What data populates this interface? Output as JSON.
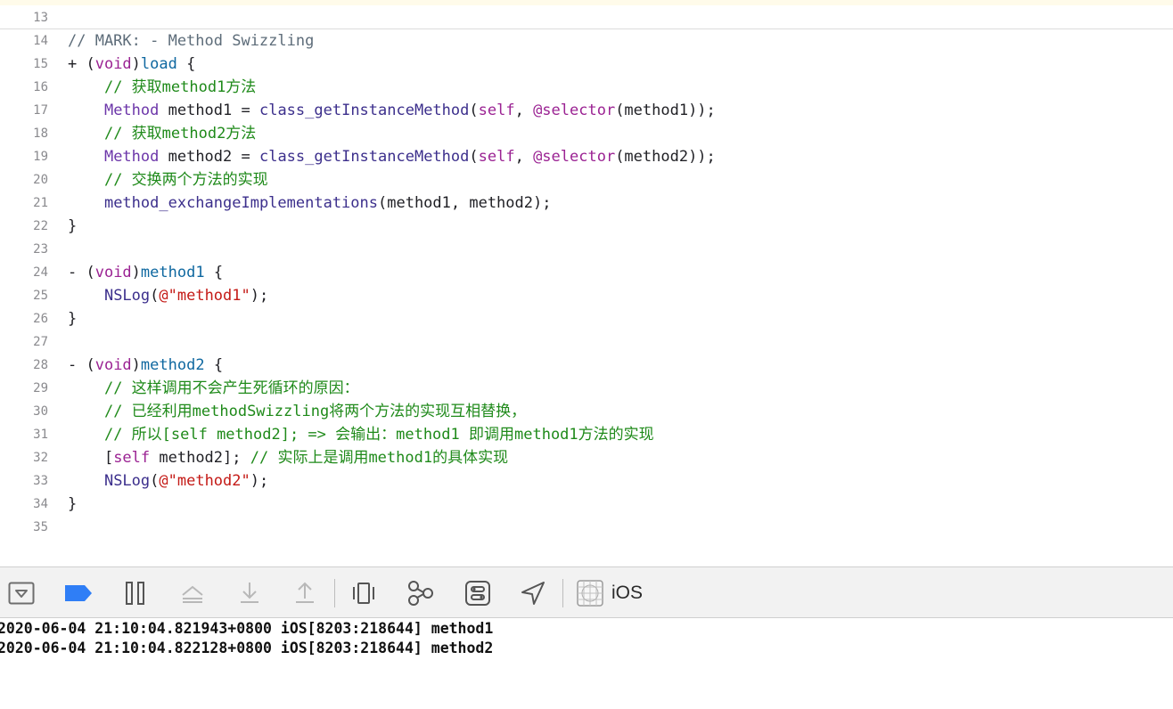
{
  "editor": {
    "lines": [
      {
        "num": "13",
        "tokens": []
      },
      {
        "num": "14",
        "tokens": [
          {
            "t": "// MARK: - Method Swizzling",
            "c": "comment-gray"
          }
        ]
      },
      {
        "num": "15",
        "tokens": [
          {
            "t": "+ (",
            "c": "plain"
          },
          {
            "t": "void",
            "c": "keyword"
          },
          {
            "t": ")",
            "c": "plain"
          },
          {
            "t": "load",
            "c": "decl"
          },
          {
            "t": " {",
            "c": "plain"
          }
        ]
      },
      {
        "num": "16",
        "tokens": [
          {
            "t": "    ",
            "c": "plain"
          },
          {
            "t": "// 获取method1方法",
            "c": "comment"
          }
        ]
      },
      {
        "num": "17",
        "tokens": [
          {
            "t": "    ",
            "c": "plain"
          },
          {
            "t": "Method",
            "c": "type"
          },
          {
            "t": " method1 = ",
            "c": "plain"
          },
          {
            "t": "class_getInstanceMethod",
            "c": "func"
          },
          {
            "t": "(",
            "c": "plain"
          },
          {
            "t": "self",
            "c": "keyword"
          },
          {
            "t": ", ",
            "c": "plain"
          },
          {
            "t": "@selector",
            "c": "keyword"
          },
          {
            "t": "(method1));",
            "c": "plain"
          }
        ]
      },
      {
        "num": "18",
        "tokens": [
          {
            "t": "    ",
            "c": "plain"
          },
          {
            "t": "// 获取method2方法",
            "c": "comment"
          }
        ]
      },
      {
        "num": "19",
        "tokens": [
          {
            "t": "    ",
            "c": "plain"
          },
          {
            "t": "Method",
            "c": "type"
          },
          {
            "t": " method2 = ",
            "c": "plain"
          },
          {
            "t": "class_getInstanceMethod",
            "c": "func"
          },
          {
            "t": "(",
            "c": "plain"
          },
          {
            "t": "self",
            "c": "keyword"
          },
          {
            "t": ", ",
            "c": "plain"
          },
          {
            "t": "@selector",
            "c": "keyword"
          },
          {
            "t": "(method2));",
            "c": "plain"
          }
        ]
      },
      {
        "num": "20",
        "tokens": [
          {
            "t": "    ",
            "c": "plain"
          },
          {
            "t": "// 交换两个方法的实现",
            "c": "comment"
          }
        ]
      },
      {
        "num": "21",
        "tokens": [
          {
            "t": "    ",
            "c": "plain"
          },
          {
            "t": "method_exchangeImplementations",
            "c": "func"
          },
          {
            "t": "(method1, method2);",
            "c": "plain"
          }
        ]
      },
      {
        "num": "22",
        "tokens": [
          {
            "t": "}",
            "c": "plain"
          }
        ]
      },
      {
        "num": "23",
        "tokens": []
      },
      {
        "num": "24",
        "tokens": [
          {
            "t": "- (",
            "c": "plain"
          },
          {
            "t": "void",
            "c": "keyword"
          },
          {
            "t": ")",
            "c": "plain"
          },
          {
            "t": "method1",
            "c": "decl"
          },
          {
            "t": " {",
            "c": "plain"
          }
        ]
      },
      {
        "num": "25",
        "tokens": [
          {
            "t": "    ",
            "c": "plain"
          },
          {
            "t": "NSLog",
            "c": "func"
          },
          {
            "t": "(",
            "c": "plain"
          },
          {
            "t": "@\"method1\"",
            "c": "string"
          },
          {
            "t": ");",
            "c": "plain"
          }
        ]
      },
      {
        "num": "26",
        "tokens": [
          {
            "t": "}",
            "c": "plain"
          }
        ]
      },
      {
        "num": "27",
        "tokens": []
      },
      {
        "num": "28",
        "tokens": [
          {
            "t": "- (",
            "c": "plain"
          },
          {
            "t": "void",
            "c": "keyword"
          },
          {
            "t": ")",
            "c": "plain"
          },
          {
            "t": "method2",
            "c": "decl"
          },
          {
            "t": " {",
            "c": "plain"
          }
        ]
      },
      {
        "num": "29",
        "tokens": [
          {
            "t": "    ",
            "c": "plain"
          },
          {
            "t": "// 这样调用不会产生死循环的原因：",
            "c": "comment"
          }
        ]
      },
      {
        "num": "30",
        "tokens": [
          {
            "t": "    ",
            "c": "plain"
          },
          {
            "t": "// 已经利用methodSwizzling将两个方法的实现互相替换，",
            "c": "comment"
          }
        ]
      },
      {
        "num": "31",
        "tokens": [
          {
            "t": "    ",
            "c": "plain"
          },
          {
            "t": "// 所以[self method2]; => 会输出：method1 即调用method1方法的实现",
            "c": "comment"
          }
        ]
      },
      {
        "num": "32",
        "tokens": [
          {
            "t": "    [",
            "c": "plain"
          },
          {
            "t": "self",
            "c": "keyword"
          },
          {
            "t": " method2]; ",
            "c": "plain"
          },
          {
            "t": "// 实际上是调用method1的具体实现",
            "c": "comment"
          }
        ]
      },
      {
        "num": "33",
        "tokens": [
          {
            "t": "    ",
            "c": "plain"
          },
          {
            "t": "NSLog",
            "c": "func"
          },
          {
            "t": "(",
            "c": "plain"
          },
          {
            "t": "@\"method2\"",
            "c": "string"
          },
          {
            "t": ");",
            "c": "plain"
          }
        ]
      },
      {
        "num": "34",
        "tokens": [
          {
            "t": "}",
            "c": "plain"
          }
        ]
      },
      {
        "num": "35",
        "tokens": []
      }
    ]
  },
  "toolbar": {
    "buttons": [
      {
        "name": "hide-debug-area-icon"
      },
      {
        "name": "breakpoints-toggle-icon"
      },
      {
        "name": "pause-icon"
      },
      {
        "name": "step-over-icon"
      },
      {
        "name": "step-into-icon"
      },
      {
        "name": "step-out-icon"
      },
      {
        "name": "view-hierarchy-icon"
      },
      {
        "name": "memory-graph-icon"
      },
      {
        "name": "environment-overrides-icon"
      },
      {
        "name": "simulate-location-icon"
      },
      {
        "name": "target-app-icon"
      }
    ],
    "target_label": "iOS"
  },
  "console": {
    "lines": [
      "2020-06-04 21:10:04.821943+0800 iOS[8203:218644] method1",
      "2020-06-04 21:10:04.822128+0800 iOS[8203:218644] method2"
    ]
  },
  "colors": {
    "accent": "#2f7ef6",
    "comment": "#1f8a1a",
    "keyword": "#9b2393",
    "string": "#c41a16"
  }
}
